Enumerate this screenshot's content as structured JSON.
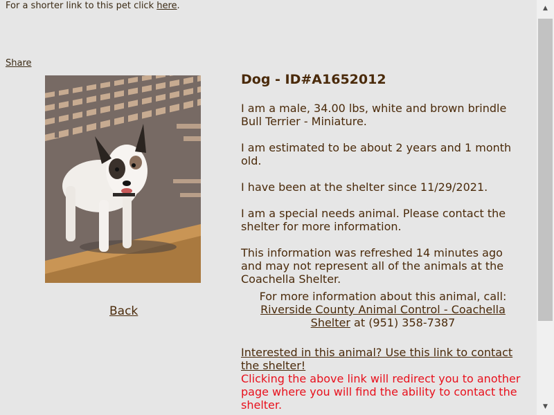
{
  "top": {
    "shortlink_prefix": "For a shorter link to this pet click ",
    "shortlink_link": "here",
    "shortlink_suffix": "."
  },
  "share_label": "Share",
  "photo": {
    "icon": "dog-photo"
  },
  "back_label": "Back",
  "animal": {
    "title": "Dog - ID#A1652012",
    "description": "I am a male, 34.00 lbs, white and brown brindle Bull Terrier - Miniature.",
    "age": "I am estimated to be about 2 years and 1 month old.",
    "since": "I have been at the shelter since 11/29/2021.",
    "special_needs": "I am a special needs animal. Please contact the shelter for more information.",
    "refresh_note": "This information was refreshed 14 minutes ago and may not represent all of the animals at the Coachella Shelter."
  },
  "contact": {
    "intro": "For more information about this animal, call:",
    "shelter_link": "Riverside County Animal Control - Coachella Shelter",
    "phone_text": " at (951) 358-7387"
  },
  "interest": {
    "link": "Interested in this animal? Use this link to contact the shelter!",
    "warning": "Clicking the above link will redirect you to another page where you will find the ability to contact the shelter."
  },
  "colors": {
    "background": "#e6e6e6",
    "text": "#4a2a0a",
    "warning": "#e8101c"
  }
}
